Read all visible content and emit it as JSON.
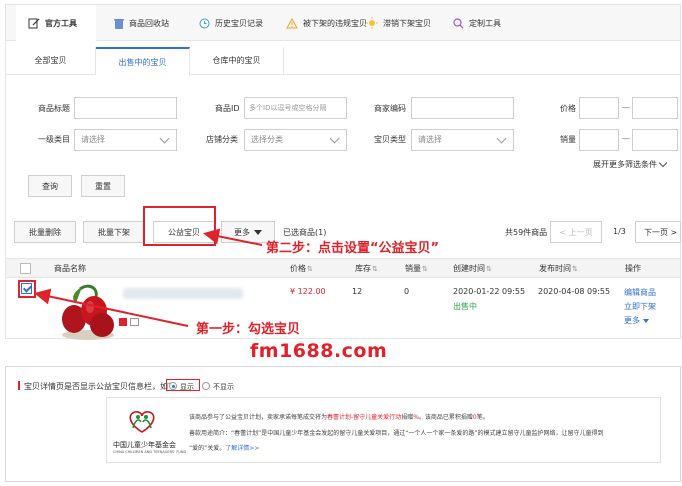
{
  "toolbar": {
    "items": [
      {
        "label": "官方工具",
        "icon": "edit-icon"
      },
      {
        "label": "商品回收站",
        "icon": "trash-icon"
      },
      {
        "label": "历史宝贝记录",
        "icon": "history-icon"
      },
      {
        "label": "被下架的违规宝贝",
        "icon": "warning-icon"
      },
      {
        "label": "滞销下架宝贝",
        "icon": "sun-icon"
      },
      {
        "label": "定制工具",
        "icon": "search-icon"
      }
    ]
  },
  "tabs": [
    "全部宝贝",
    "出售中的宝贝",
    "仓库中的宝贝"
  ],
  "filters": {
    "product_title_label": "商品标题",
    "product_id_label": "商品ID",
    "product_id_placeholder": "多个ID以逗号或空格分隔",
    "merchant_code_label": "商家编码",
    "price_label": "价格",
    "category_label": "一级类目",
    "category_value": "请选择",
    "shop_category_label": "店铺分类",
    "shop_category_value": "选择分类",
    "item_type_label": "宝贝类型",
    "item_type_value": "请选择",
    "sales_label": "销量",
    "range_dash": "—",
    "expand_label": "展开更多筛选条件",
    "search_button": "查询",
    "reset_button": "重置"
  },
  "actions": {
    "batch_delete": "批量删除",
    "batch_delist": "批量下架",
    "charity": "公益宝贝",
    "more": "更多",
    "selected": "已选商品(1)",
    "total": "共59件商品",
    "prev": "< 上一页",
    "page": "1/3",
    "next": "下一页 >"
  },
  "table": {
    "headers": [
      "商品名称",
      "价格",
      "库存",
      "销量",
      "创建时间",
      "发布时间",
      "操作"
    ],
    "row": {
      "price": "¥ 122.00",
      "stock": "12",
      "sales": "0",
      "created": "2020-01-22 09:55",
      "status": "出售中",
      "published": "2020-04-08 09:55",
      "op_edit": "编辑商品",
      "op_delist": "立即下架",
      "op_more": "更多"
    }
  },
  "annotations": {
    "step1": "第一步：勾选宝贝",
    "step2": "第二步：点击设置“公益宝贝”"
  },
  "watermark": "fm1688.com",
  "charity_panel": {
    "question": "宝贝详情页是否显示公益宝贝信息栏，如下",
    "show": "显示",
    "hide": "不显示",
    "line1_a": "该商品参与了公益宝贝计划，卖家承诺每笔成交将为",
    "line1_b": "春蕾计划-留守儿童关爱行动",
    "line1_c": "捐赠",
    "line1_d": "%",
    "line1_e": "。该商品已累积捐赠",
    "line1_f": "0",
    "line1_g": "笔。",
    "line2_a": "善款用途简介：",
    "line2_b": "“春蕾计划”是中国儿童少年基金会发起的留守儿童关爱项目，通过“一个人一个家一条爱的路”的模式建立留守儿童监护网络，让留守儿童得到",
    "line3_a": "“爱的”关爱。",
    "line3_b": "了解详情>>",
    "logo_name": "中国儿童少年基金会",
    "logo_en": "CHINA CHILDREN AND TEENAGERS' FUND"
  },
  "colors": {
    "accent": "#2f6fd8",
    "annotation_red": "#e0222a",
    "status_green": "#2aa24a"
  }
}
